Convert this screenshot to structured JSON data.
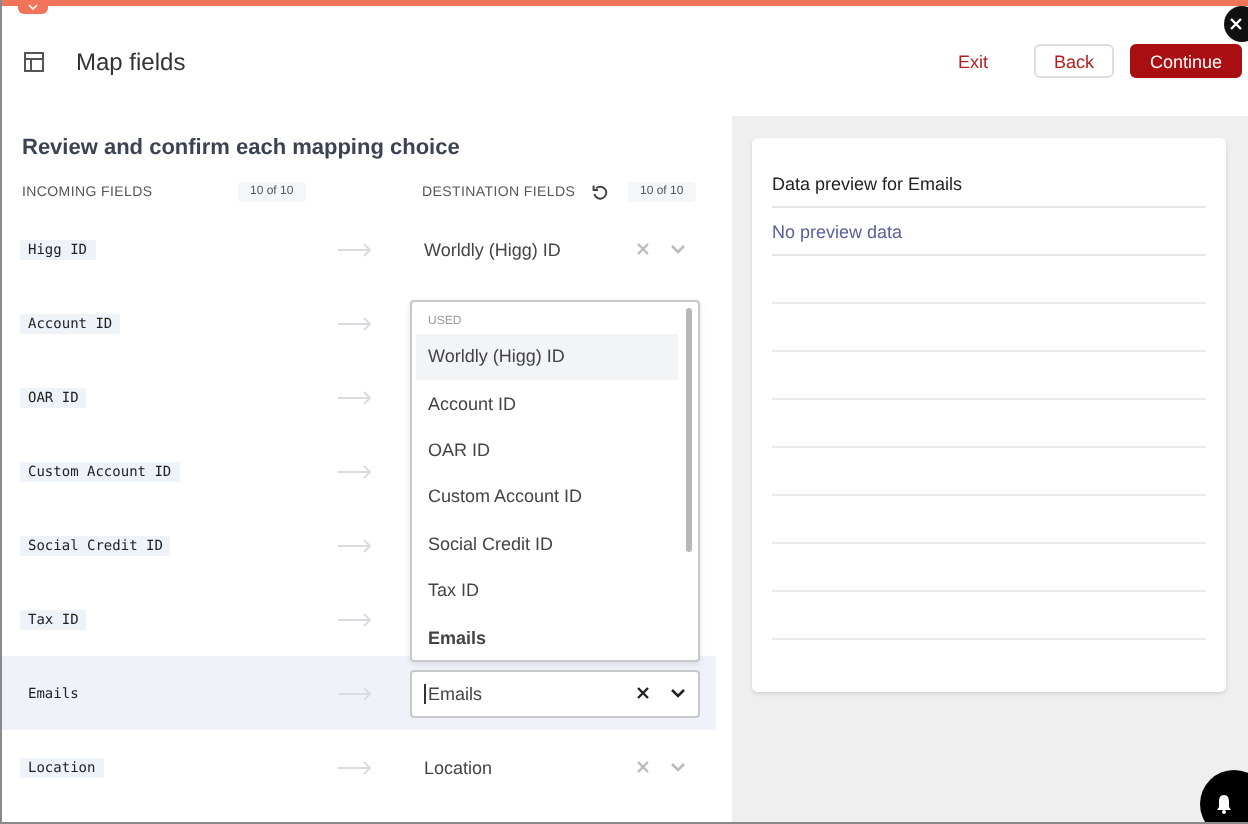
{
  "header": {
    "title": "Map fields",
    "buttons": [
      {
        "label": "Exit",
        "kind": "link"
      },
      {
        "label": "Back",
        "kind": "secondary"
      },
      {
        "label": "Continue",
        "kind": "primary"
      }
    ]
  },
  "mapping": {
    "heading": "Review and confirm each mapping choice",
    "incoming_header": "INCOMING FIELDS",
    "incoming_count": "10 of 10",
    "destination_header": "DESTINATION FIELDS",
    "destination_count": "10 of 10",
    "rows": [
      {
        "incoming": "Higg ID",
        "destination": "Worldly (Higg) ID",
        "selected": false
      },
      {
        "incoming": "Account ID",
        "selected": false
      },
      {
        "incoming": "OAR ID",
        "selected": false
      },
      {
        "incoming": "Custom Account ID",
        "selected": false
      },
      {
        "incoming": "Social Credit ID",
        "selected": false
      },
      {
        "incoming": "Tax ID",
        "selected": false
      },
      {
        "incoming": "Emails",
        "destination": "Emails",
        "selected": true,
        "dropdown": {
          "group": "USED",
          "options": [
            {
              "label": "Worldly (Higg) ID",
              "highlighted": true,
              "selected": false
            },
            {
              "label": "Account ID",
              "highlighted": false,
              "selected": false
            },
            {
              "label": "OAR ID",
              "highlighted": false,
              "selected": false
            },
            {
              "label": "Custom Account ID",
              "highlighted": false,
              "selected": false
            },
            {
              "label": "Social Credit ID",
              "highlighted": false,
              "selected": false
            },
            {
              "label": "Tax ID",
              "highlighted": false,
              "selected": false
            },
            {
              "label": "Emails",
              "highlighted": false,
              "selected": true
            }
          ]
        }
      },
      {
        "incoming": "Location",
        "destination": "Location",
        "selected": false
      }
    ]
  },
  "preview": {
    "title": "Data preview for Emails",
    "empty_text": "No preview data"
  }
}
